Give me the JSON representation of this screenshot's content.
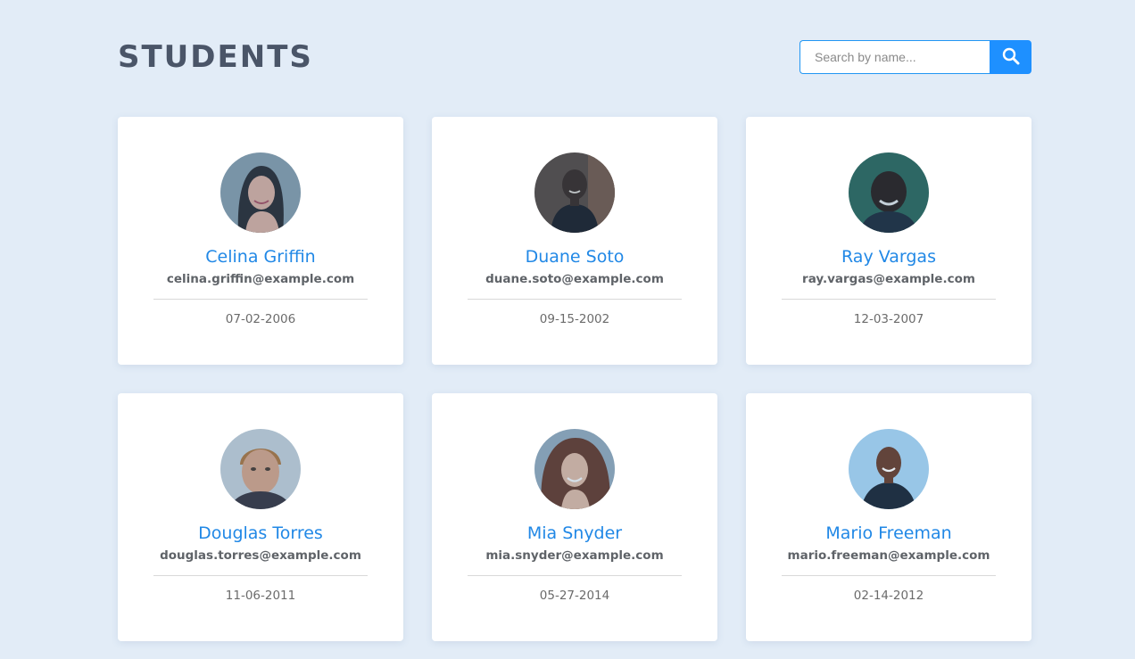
{
  "header": {
    "title": "STUDENTS",
    "search_placeholder": "Search by name...",
    "search_icon": "search-icon"
  },
  "colors": {
    "background": "#e2ecf7",
    "accent": "#1e90ff",
    "name": "#2188e6",
    "title": "#4a5568"
  },
  "students": [
    {
      "name": "Celina Griffin",
      "email": "celina.griffin@example.com",
      "dob": "07-02-2006",
      "avatar": "woman-portrait"
    },
    {
      "name": "Duane Soto",
      "email": "duane.soto@example.com",
      "dob": "09-15-2002",
      "avatar": "man-portrait"
    },
    {
      "name": "Ray Vargas",
      "email": "ray.vargas@example.com",
      "dob": "12-03-2007",
      "avatar": "man-portrait"
    },
    {
      "name": "Douglas Torres",
      "email": "douglas.torres@example.com",
      "dob": "11-06-2011",
      "avatar": "man-portrait"
    },
    {
      "name": "Mia Snyder",
      "email": "mia.snyder@example.com",
      "dob": "05-27-2014",
      "avatar": "woman-portrait"
    },
    {
      "name": "Mario Freeman",
      "email": "mario.freeman@example.com",
      "dob": "02-14-2012",
      "avatar": "man-portrait"
    }
  ]
}
